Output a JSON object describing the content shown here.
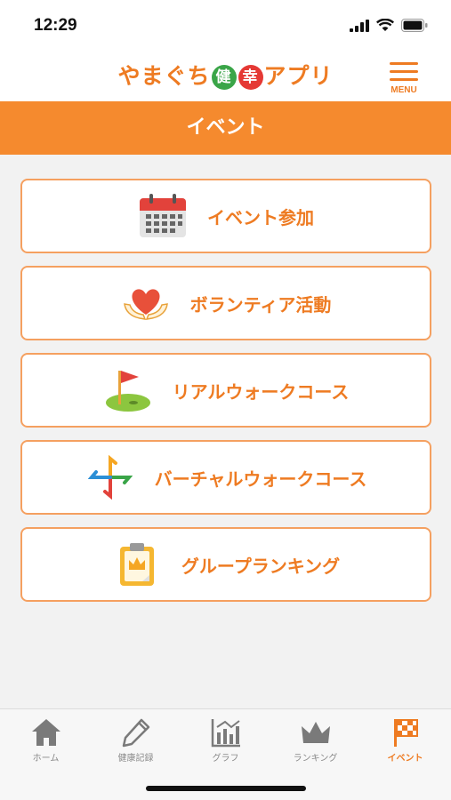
{
  "status_bar": {
    "time": "12:29"
  },
  "header": {
    "logo_prefix": "やまぐち",
    "logo_badge_1": "健",
    "logo_badge_2": "幸",
    "logo_suffix": "アプリ",
    "menu_label": "MENU"
  },
  "page": {
    "title": "イベント"
  },
  "menu_items": [
    {
      "label": "イベント参加",
      "icon": "calendar-icon"
    },
    {
      "label": "ボランティア活動",
      "icon": "heart-hands-icon"
    },
    {
      "label": "リアルウォークコース",
      "icon": "golf-flag-icon"
    },
    {
      "label": "バーチャルウォークコース",
      "icon": "pinwheel-icon"
    },
    {
      "label": "グループランキング",
      "icon": "crown-clipboard-icon"
    }
  ],
  "tab_bar": {
    "tabs": [
      {
        "label": "ホーム",
        "icon": "home-icon"
      },
      {
        "label": "健康記録",
        "icon": "pencil-icon"
      },
      {
        "label": "グラフ",
        "icon": "chart-icon"
      },
      {
        "label": "ランキング",
        "icon": "crown-icon"
      },
      {
        "label": "イベント",
        "icon": "checkered-flag-icon"
      }
    ],
    "active_index": 4
  },
  "colors": {
    "accent": "#ee7b22",
    "title_bar": "#f58a2e",
    "card_border": "#f5a060",
    "badge_green": "#3aa548",
    "badge_red": "#e53935",
    "inactive_tab": "#8a8a8a"
  }
}
